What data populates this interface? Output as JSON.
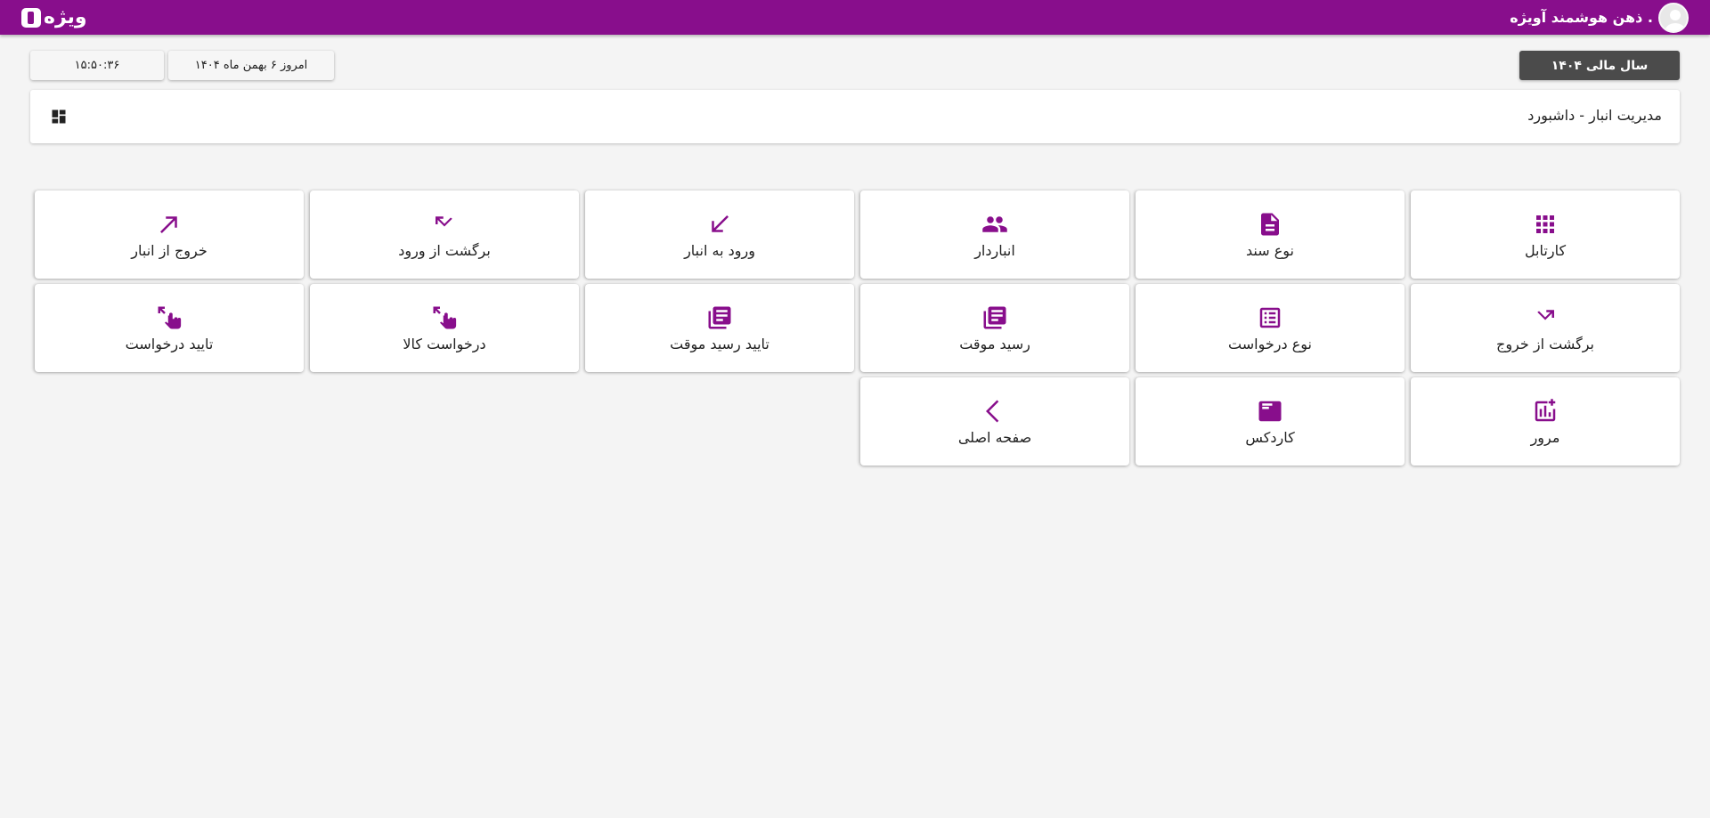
{
  "app": {
    "logo_text": "ویژه",
    "user_name": "ذهن هوشمند آویژه ."
  },
  "toolbar": {
    "fiscal_year": "سال مالی ۱۴۰۴",
    "date": "امروز ۶ بهمن ماه ۱۴۰۴",
    "time": "۱۵:۵۰:۳۶"
  },
  "page": {
    "title": "مدیریت انبار - داشبورد"
  },
  "tiles": [
    {
      "label": "کارتابل",
      "icon": "apps-grid-icon"
    },
    {
      "label": "نوع سند",
      "icon": "document-icon"
    },
    {
      "label": "انباردار",
      "icon": "people-icon"
    },
    {
      "label": "ورود به انبار",
      "icon": "arrow-down-left-icon"
    },
    {
      "label": "برگشت از ورود",
      "icon": "return-arrow-icon"
    },
    {
      "label": "خروج از انبار",
      "icon": "arrow-up-right-icon"
    },
    {
      "label": "برگشت از خروج",
      "icon": "return-trend-icon"
    },
    {
      "label": "نوع درخواست",
      "icon": "list-box-icon"
    },
    {
      "label": "رسید موقت",
      "icon": "library-books-icon"
    },
    {
      "label": "تایید رسید موقت",
      "icon": "library-books-icon"
    },
    {
      "label": "درخواست کالا",
      "icon": "tap-expand-icon"
    },
    {
      "label": "تایید درخواست",
      "icon": "tap-expand-icon"
    },
    {
      "label": "مرور",
      "icon": "add-chart-icon"
    },
    {
      "label": "کاردکس",
      "icon": "card-icon"
    },
    {
      "label": "صفحه اصلی",
      "icon": "chevron-left-icon"
    }
  ],
  "colors": {
    "brand": "#880e8c",
    "fiscal_button": "#4b4b4b"
  }
}
